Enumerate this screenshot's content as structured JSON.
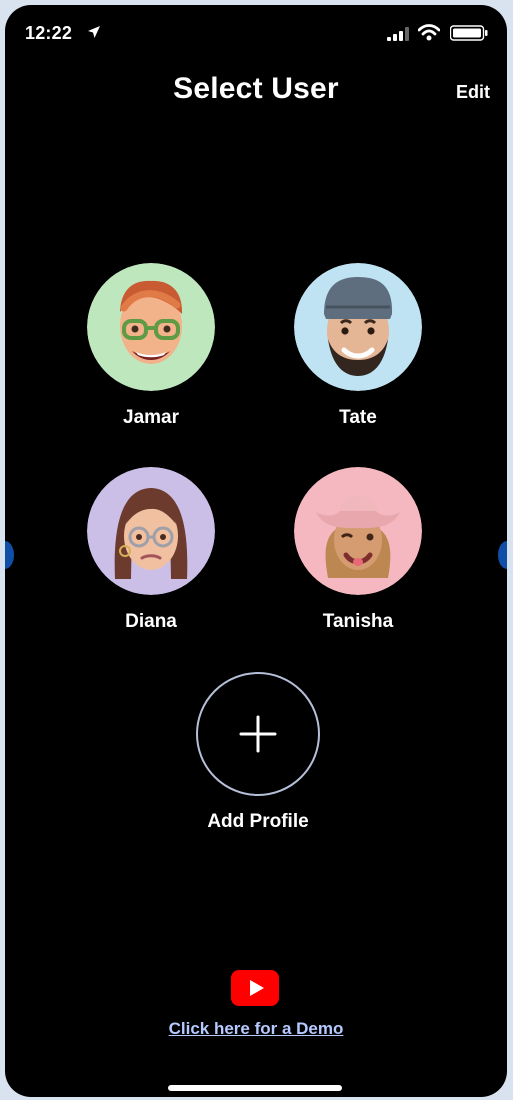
{
  "status_bar": {
    "time": "12:22",
    "location_icon": "location-arrow-icon",
    "signal_icon": "signal-icon",
    "wifi_icon": "wifi-icon",
    "battery_icon": "battery-icon"
  },
  "header": {
    "title": "Select User",
    "edit_label": "Edit"
  },
  "profiles": [
    {
      "name": "Jamar",
      "avatar_icon": "memoji-avatar-jamar",
      "background_color": "#bfe7be"
    },
    {
      "name": "Tate",
      "avatar_icon": "memoji-avatar-tate",
      "background_color": "#bfe3f3"
    },
    {
      "name": "Diana",
      "avatar_icon": "memoji-avatar-diana",
      "background_color": "#cbbfe8"
    },
    {
      "name": "Tanisha",
      "avatar_icon": "memoji-avatar-tanisha",
      "background_color": "#f5b8c0"
    }
  ],
  "add_profile": {
    "label": "Add Profile",
    "icon": "plus-icon"
  },
  "demo": {
    "icon": "youtube-play-icon",
    "link_text": "Click here for a Demo",
    "link_color": "#b6c9ff"
  },
  "colors": {
    "background": "#000000",
    "text": "#ffffff",
    "youtube_red": "#ff0000",
    "handle_blue": "#0f4fa8"
  }
}
